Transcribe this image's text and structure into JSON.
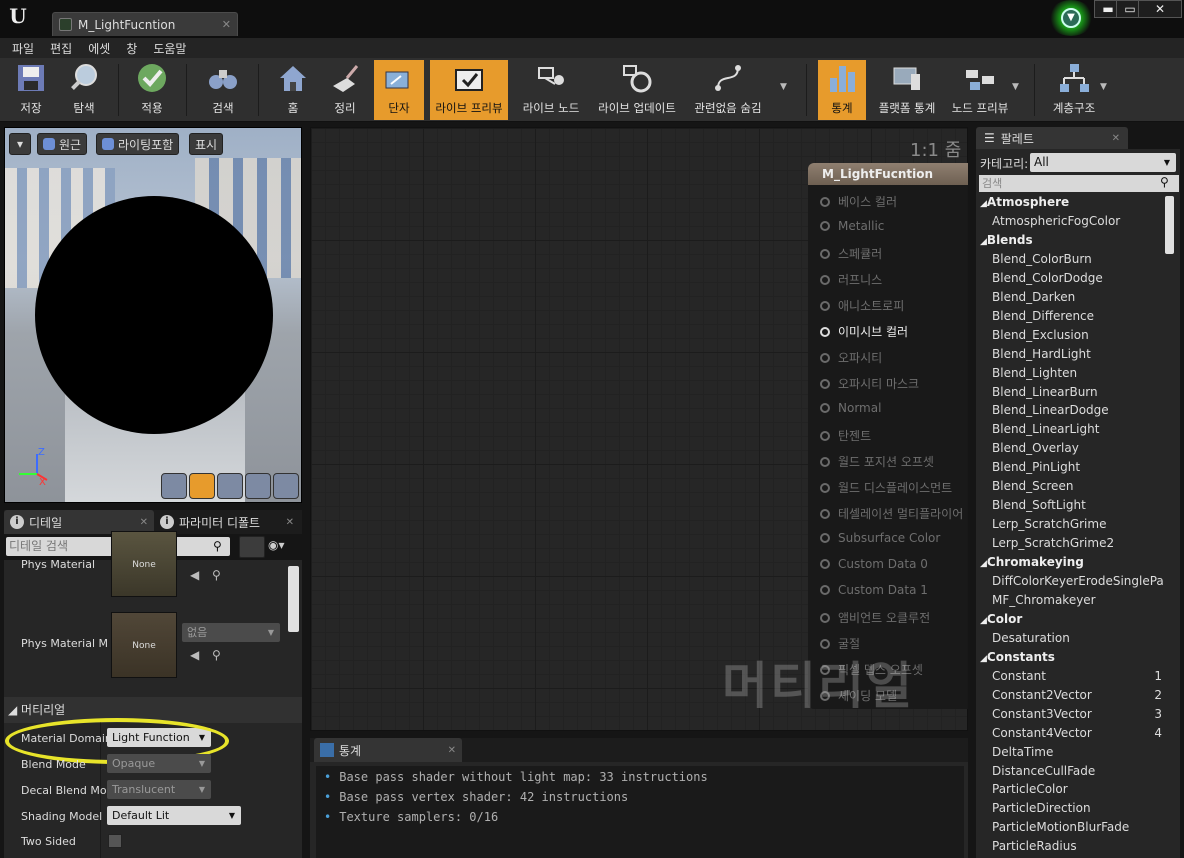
{
  "window": {
    "tab_title": "M_LightFucntion",
    "minimize": "▬",
    "maximize": "▭",
    "close": "✕"
  },
  "menu": [
    "파일",
    "편집",
    "에셋",
    "창",
    "도움말"
  ],
  "toolbar": {
    "save": "저장",
    "browse": "탐색",
    "apply": "적용",
    "search": "검색",
    "home": "홈",
    "clean_up": "정리",
    "connectors": "단자",
    "live_preview": "라이브 프리뷰",
    "live_nodes": "라이브 노드",
    "live_update": "라이브 업데이트",
    "hide_unrelated": "관련없음 숨김",
    "stats": "통계",
    "platform_stats": "플랫폼 통계",
    "node_preview": "노드 프리뷰",
    "hierarchy": "계층구조"
  },
  "viewport": {
    "perspective": "원근",
    "lit": "라이팅포함",
    "show": "표시",
    "axis_z": "Z",
    "axis_x": "X"
  },
  "details": {
    "tab_details": "디테일",
    "tab_params": "파라미터 디폴트",
    "search_placeholder": "디테일 검색",
    "phys_material": "Phys Material",
    "phys_material_mask": "Phys Material M",
    "thumb_none": "None",
    "none_value": "없음",
    "section_material": "머티리얼",
    "material_domain_label": "Material Domain",
    "material_domain_value": "Light Function",
    "blend_mode_label": "Blend Mode",
    "blend_mode_value": "Opaque",
    "decal_blend_label": "Decal Blend Moc",
    "decal_blend_value": "Translucent",
    "shading_model_label": "Shading Model",
    "shading_model_value": "Default Lit",
    "two_sided_label": "Two Sided"
  },
  "graph": {
    "zoom": "1:1 줌",
    "watermark": "머티리얼",
    "node_title": "M_LightFucntion",
    "pins": [
      {
        "label": "베이스 컬러",
        "active": false
      },
      {
        "label": "Metallic",
        "active": false
      },
      {
        "label": "스페큘러",
        "active": false
      },
      {
        "label": "러프니스",
        "active": false
      },
      {
        "label": "애니소트로피",
        "active": false
      },
      {
        "label": "이미시브 컬러",
        "active": true
      },
      {
        "label": "오파시티",
        "active": false
      },
      {
        "label": "오파시티 마스크",
        "active": false
      },
      {
        "label": "Normal",
        "active": false
      },
      {
        "label": "탄젠트",
        "active": false
      },
      {
        "label": "월드 포지션 오프셋",
        "active": false
      },
      {
        "label": "월드 디스플레이스먼트",
        "active": false
      },
      {
        "label": "테셀레이션 멀티플라이어",
        "active": false
      },
      {
        "label": "Subsurface Color",
        "active": false
      },
      {
        "label": "Custom Data 0",
        "active": false
      },
      {
        "label": "Custom Data 1",
        "active": false
      },
      {
        "label": "앰비언트 오클루전",
        "active": false
      },
      {
        "label": "굴절",
        "active": false
      },
      {
        "label": "픽셀 뎁스 오프셋",
        "active": false
      },
      {
        "label": "셰이딩 모델",
        "active": false
      }
    ]
  },
  "stats": {
    "tab": "통계",
    "lines": [
      "Base pass shader without light map: 33 instructions",
      "Base pass vertex shader: 42 instructions",
      "Texture samplers: 0/16"
    ]
  },
  "palette": {
    "tab": "팔레트",
    "category_label": "카테고리:",
    "category_value": "All",
    "search_placeholder": "검색",
    "rows": [
      {
        "label": "Atmosphere",
        "cat": true,
        "n": ""
      },
      {
        "label": "AtmosphericFogColor",
        "cat": false,
        "n": ""
      },
      {
        "label": "Blends",
        "cat": true,
        "n": ""
      },
      {
        "label": "Blend_ColorBurn",
        "cat": false,
        "n": ""
      },
      {
        "label": "Blend_ColorDodge",
        "cat": false,
        "n": ""
      },
      {
        "label": "Blend_Darken",
        "cat": false,
        "n": ""
      },
      {
        "label": "Blend_Difference",
        "cat": false,
        "n": ""
      },
      {
        "label": "Blend_Exclusion",
        "cat": false,
        "n": ""
      },
      {
        "label": "Blend_HardLight",
        "cat": false,
        "n": ""
      },
      {
        "label": "Blend_Lighten",
        "cat": false,
        "n": ""
      },
      {
        "label": "Blend_LinearBurn",
        "cat": false,
        "n": ""
      },
      {
        "label": "Blend_LinearDodge",
        "cat": false,
        "n": ""
      },
      {
        "label": "Blend_LinearLight",
        "cat": false,
        "n": ""
      },
      {
        "label": "Blend_Overlay",
        "cat": false,
        "n": ""
      },
      {
        "label": "Blend_PinLight",
        "cat": false,
        "n": ""
      },
      {
        "label": "Blend_Screen",
        "cat": false,
        "n": ""
      },
      {
        "label": "Blend_SoftLight",
        "cat": false,
        "n": ""
      },
      {
        "label": "Lerp_ScratchGrime",
        "cat": false,
        "n": ""
      },
      {
        "label": "Lerp_ScratchGrime2",
        "cat": false,
        "n": ""
      },
      {
        "label": "Chromakeying",
        "cat": true,
        "n": ""
      },
      {
        "label": "DiffColorKeyerErodeSinglePa",
        "cat": false,
        "n": ""
      },
      {
        "label": "MF_Chromakeyer",
        "cat": false,
        "n": ""
      },
      {
        "label": "Color",
        "cat": true,
        "n": ""
      },
      {
        "label": "Desaturation",
        "cat": false,
        "n": ""
      },
      {
        "label": "Constants",
        "cat": true,
        "n": ""
      },
      {
        "label": "Constant",
        "cat": false,
        "n": "1"
      },
      {
        "label": "Constant2Vector",
        "cat": false,
        "n": "2"
      },
      {
        "label": "Constant3Vector",
        "cat": false,
        "n": "3"
      },
      {
        "label": "Constant4Vector",
        "cat": false,
        "n": "4"
      },
      {
        "label": "DeltaTime",
        "cat": false,
        "n": ""
      },
      {
        "label": "DistanceCullFade",
        "cat": false,
        "n": ""
      },
      {
        "label": "ParticleColor",
        "cat": false,
        "n": ""
      },
      {
        "label": "ParticleDirection",
        "cat": false,
        "n": ""
      },
      {
        "label": "ParticleMotionBlurFade",
        "cat": false,
        "n": ""
      },
      {
        "label": "ParticleRadius",
        "cat": false,
        "n": ""
      }
    ]
  },
  "colors": {
    "accent": "#e79b2c",
    "highlight": "#e8e42a"
  }
}
